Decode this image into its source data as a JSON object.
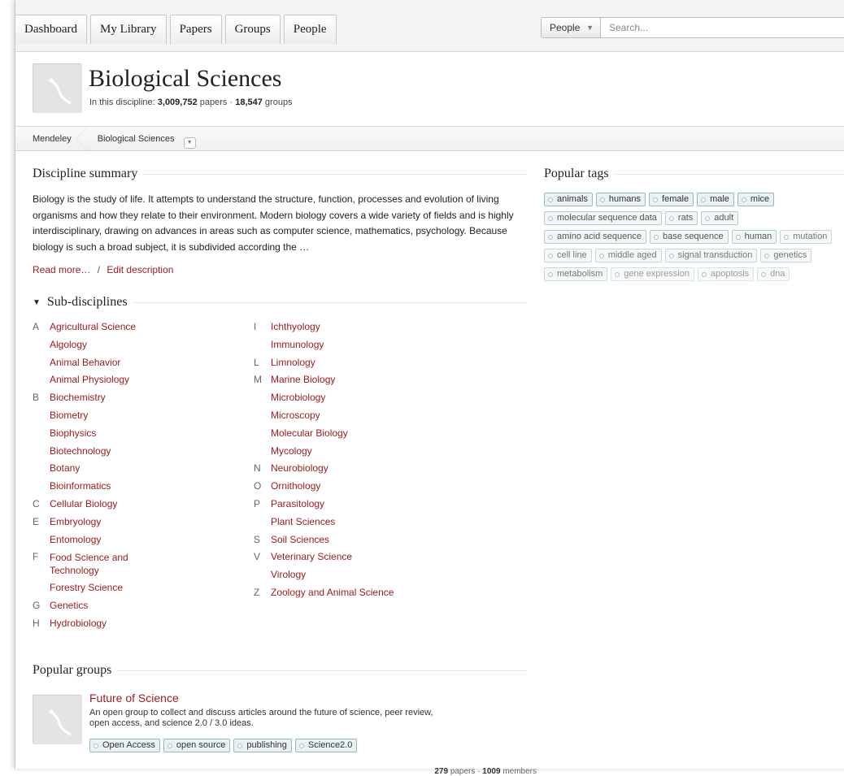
{
  "nav": {
    "tabs": [
      "Dashboard",
      "My Library",
      "Papers",
      "Groups",
      "People"
    ]
  },
  "search": {
    "scope": "People",
    "placeholder": "Search..."
  },
  "discipline": {
    "title": "Biological Sciences",
    "stats_prefix": "In this discipline: ",
    "papers": "3,009,752",
    "papers_label": "papers",
    "groups": "18,547",
    "groups_label": "groups"
  },
  "breadcrumb": {
    "root": "Mendeley",
    "current": "Biological Sciences"
  },
  "summary": {
    "title": "Discipline summary",
    "text": "Biology is the study of life. It attempts to understand the structure, function, processes and evolution of living organisms and how they relate to their environment. Modern biology covers a wide variety of fields and is highly interdisciplinary, drawing on advances in areas such as computer science, mathematics, psychology. Because biology is such a broad subject, it is subdivided according the …",
    "read_more": "Read more…",
    "separator": "/",
    "edit": "Edit description"
  },
  "subdisciplines": {
    "title": "Sub-disciplines",
    "left": [
      {
        "letter": "A",
        "name": "Agricultural Science"
      },
      {
        "letter": "",
        "name": "Algology"
      },
      {
        "letter": "",
        "name": "Animal Behavior"
      },
      {
        "letter": "",
        "name": "Animal Physiology"
      },
      {
        "letter": "B",
        "name": "Biochemistry"
      },
      {
        "letter": "",
        "name": "Biometry"
      },
      {
        "letter": "",
        "name": "Biophysics"
      },
      {
        "letter": "",
        "name": "Biotechnology"
      },
      {
        "letter": "",
        "name": "Botany"
      },
      {
        "letter": "",
        "name": "Bioinformatics"
      },
      {
        "letter": "C",
        "name": "Cellular Biology"
      },
      {
        "letter": "E",
        "name": "Embryology"
      },
      {
        "letter": "",
        "name": "Entomology"
      },
      {
        "letter": "F",
        "name": "Food Science and Technology"
      },
      {
        "letter": "",
        "name": "Forestry Science"
      },
      {
        "letter": "G",
        "name": "Genetics"
      },
      {
        "letter": "H",
        "name": "Hydrobiology"
      }
    ],
    "right": [
      {
        "letter": "I",
        "name": "Ichthyology"
      },
      {
        "letter": "",
        "name": "Immunology"
      },
      {
        "letter": "L",
        "name": "Limnology"
      },
      {
        "letter": "M",
        "name": "Marine Biology"
      },
      {
        "letter": "",
        "name": "Microbiology"
      },
      {
        "letter": "",
        "name": "Microscopy"
      },
      {
        "letter": "",
        "name": "Molecular Biology"
      },
      {
        "letter": "",
        "name": "Mycology"
      },
      {
        "letter": "N",
        "name": "Neurobiology"
      },
      {
        "letter": "O",
        "name": "Ornithology"
      },
      {
        "letter": "P",
        "name": "Parasitology"
      },
      {
        "letter": "",
        "name": "Plant Sciences"
      },
      {
        "letter": "S",
        "name": "Soil Sciences"
      },
      {
        "letter": "V",
        "name": "Veterinary Science"
      },
      {
        "letter": "",
        "name": "Virology"
      },
      {
        "letter": "Z",
        "name": "Zoology and Animal Science"
      }
    ]
  },
  "popular_tags": {
    "title": "Popular tags",
    "tags": [
      {
        "name": "animals",
        "weight": 1
      },
      {
        "name": "humans",
        "weight": 1
      },
      {
        "name": "female",
        "weight": 1
      },
      {
        "name": "male",
        "weight": 1
      },
      {
        "name": "mice",
        "weight": 1
      },
      {
        "name": "molecular sequence data",
        "weight": 2
      },
      {
        "name": "rats",
        "weight": 2
      },
      {
        "name": "adult",
        "weight": 2
      },
      {
        "name": "amino acid sequence",
        "weight": 2
      },
      {
        "name": "base sequence",
        "weight": 2
      },
      {
        "name": "human",
        "weight": 2
      },
      {
        "name": "mutation",
        "weight": 3
      },
      {
        "name": "cell line",
        "weight": 3
      },
      {
        "name": "middle aged",
        "weight": 3
      },
      {
        "name": "signal transduction",
        "weight": 3
      },
      {
        "name": "genetics",
        "weight": 3
      },
      {
        "name": "metabolism",
        "weight": 3
      },
      {
        "name": "gene expression",
        "weight": 4
      },
      {
        "name": "apoptosis",
        "weight": 4
      },
      {
        "name": "dna",
        "weight": 4
      }
    ]
  },
  "popular_groups": {
    "title": "Popular groups",
    "groups": [
      {
        "name": "Future of Science",
        "description": "An open group to collect and discuss articles around the future of science, peer review, open access, and science 2.0 / 3.0 ideas.",
        "tags": [
          "Open Access",
          "open source",
          "publishing",
          "Science2.0"
        ],
        "papers": "279",
        "papers_label": "papers",
        "members": "1009",
        "members_label": "members"
      }
    ]
  },
  "icons": {
    "search": "search-icon",
    "dropdown": "chevron-down-icon",
    "tag": "tag-icon",
    "collapse": "triangle-down-icon"
  },
  "colors": {
    "link": "#9b1b1b",
    "tag_border": "#9ab9bc",
    "tag_bg": "#e9f1f2"
  }
}
